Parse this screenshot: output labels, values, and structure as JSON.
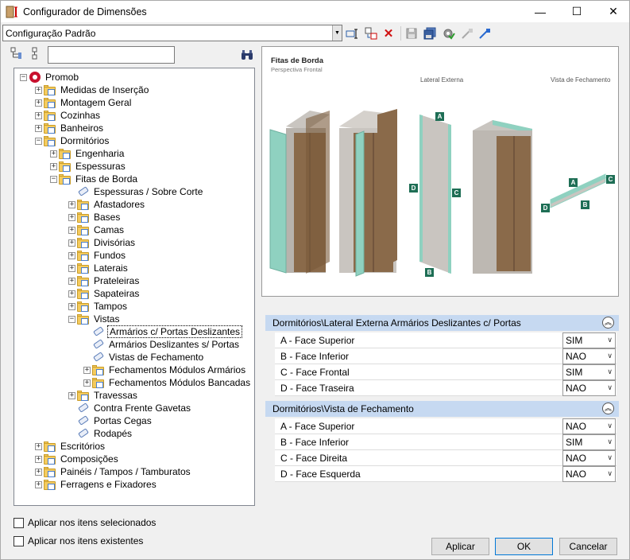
{
  "window": {
    "title": "Configurador de Dimensões",
    "minimize": "—",
    "maximize": "☐",
    "close": "✕"
  },
  "toolbar": {
    "config_value": "Configuração Padrão"
  },
  "tree": [
    {
      "label": "Promob",
      "level": 0,
      "expander": "−",
      "icon": "promob-logo-icon"
    },
    {
      "label": "Medidas de Inserção",
      "level": 1,
      "expander": "+",
      "icon": "folder"
    },
    {
      "label": "Montagem Geral",
      "level": 1,
      "expander": "+",
      "icon": "folder"
    },
    {
      "label": "Cozinhas",
      "level": 1,
      "expander": "+",
      "icon": "folder"
    },
    {
      "label": "Banheiros",
      "level": 1,
      "expander": "+",
      "icon": "folder"
    },
    {
      "label": "Dormitórios",
      "level": 1,
      "expander": "−",
      "icon": "folder"
    },
    {
      "label": "Engenharia",
      "level": 2,
      "expander": "+",
      "icon": "folder"
    },
    {
      "label": "Espessuras",
      "level": 2,
      "expander": "+",
      "icon": "folder"
    },
    {
      "label": "Fitas de Borda",
      "level": 2,
      "expander": "−",
      "icon": "folder"
    },
    {
      "label": "Espessuras / Sobre Corte",
      "level": 3,
      "expander": "",
      "icon": "tag"
    },
    {
      "label": "Afastadores",
      "level": 3,
      "expander": "+",
      "icon": "folder"
    },
    {
      "label": "Bases",
      "level": 3,
      "expander": "+",
      "icon": "folder"
    },
    {
      "label": "Camas",
      "level": 3,
      "expander": "+",
      "icon": "folder"
    },
    {
      "label": "Divisórias",
      "level": 3,
      "expander": "+",
      "icon": "folder"
    },
    {
      "label": "Fundos",
      "level": 3,
      "expander": "+",
      "icon": "folder"
    },
    {
      "label": "Laterais",
      "level": 3,
      "expander": "+",
      "icon": "folder"
    },
    {
      "label": "Prateleiras",
      "level": 3,
      "expander": "+",
      "icon": "folder"
    },
    {
      "label": "Sapateiras",
      "level": 3,
      "expander": "+",
      "icon": "folder"
    },
    {
      "label": "Tampos",
      "level": 3,
      "expander": "+",
      "icon": "folder"
    },
    {
      "label": "Vistas",
      "level": 3,
      "expander": "−",
      "icon": "folder"
    },
    {
      "label": "Armários c/ Portas Deslizantes",
      "level": 4,
      "expander": "",
      "icon": "tag",
      "selected": true
    },
    {
      "label": "Armários Deslizantes s/ Portas",
      "level": 4,
      "expander": "",
      "icon": "tag"
    },
    {
      "label": "Vistas de Fechamento",
      "level": 4,
      "expander": "",
      "icon": "tag"
    },
    {
      "label": "Fechamentos Módulos Armários",
      "level": 4,
      "expander": "+",
      "icon": "folder"
    },
    {
      "label": "Fechamentos Módulos Bancadas",
      "level": 4,
      "expander": "+",
      "icon": "folder"
    },
    {
      "label": "Travessas",
      "level": 3,
      "expander": "+",
      "icon": "folder"
    },
    {
      "label": "Contra Frente Gavetas",
      "level": 3,
      "expander": "",
      "icon": "tag"
    },
    {
      "label": "Portas Cegas",
      "level": 3,
      "expander": "",
      "icon": "tag"
    },
    {
      "label": "Rodapés",
      "level": 3,
      "expander": "",
      "icon": "tag"
    },
    {
      "label": "Escritórios",
      "level": 1,
      "expander": "+",
      "icon": "folder"
    },
    {
      "label": "Composições",
      "level": 1,
      "expander": "+",
      "icon": "folder"
    },
    {
      "label": "Painéis / Tampos / Tamburatos",
      "level": 1,
      "expander": "+",
      "icon": "folder"
    },
    {
      "label": "Ferragens e Fixadores",
      "level": 1,
      "expander": "+",
      "icon": "folder"
    }
  ],
  "checkboxes": {
    "selected_items": "Aplicar nos itens selecionados",
    "existing_items": "Aplicar nos itens existentes"
  },
  "preview": {
    "title": "Fitas de Borda",
    "subtitle": "Perspectiva Frontal",
    "label_lateral": "Lateral Externa",
    "label_vista": "Vista de Fechamento",
    "markers": [
      "A",
      "B",
      "C",
      "D"
    ]
  },
  "groups": [
    {
      "title": "Dormitórios\\Lateral Externa Armários Deslizantes c/ Portas",
      "rows": [
        {
          "name": "A - Face Superior",
          "value": "SIM"
        },
        {
          "name": "B - Face Inferior",
          "value": "NAO"
        },
        {
          "name": "C - Face Frontal",
          "value": "SIM"
        },
        {
          "name": "D - Face Traseira",
          "value": "NAO"
        }
      ]
    },
    {
      "title": "Dormitórios\\Vista de Fechamento",
      "rows": [
        {
          "name": "A - Face Superior",
          "value": "NAO"
        },
        {
          "name": "B - Face Inferior",
          "value": "SIM"
        },
        {
          "name": "C - Face Direita",
          "value": "NAO"
        },
        {
          "name": "D - Face Esquerda",
          "value": "NAO"
        }
      ]
    }
  ],
  "buttons": {
    "apply": "Aplicar",
    "ok": "OK",
    "cancel": "Cancelar"
  },
  "colors": {
    "edge_band": "#8fd1c0",
    "marker": "#1e6e55",
    "group_header": "#c6d9f1",
    "wood": "#8a6a4a"
  }
}
